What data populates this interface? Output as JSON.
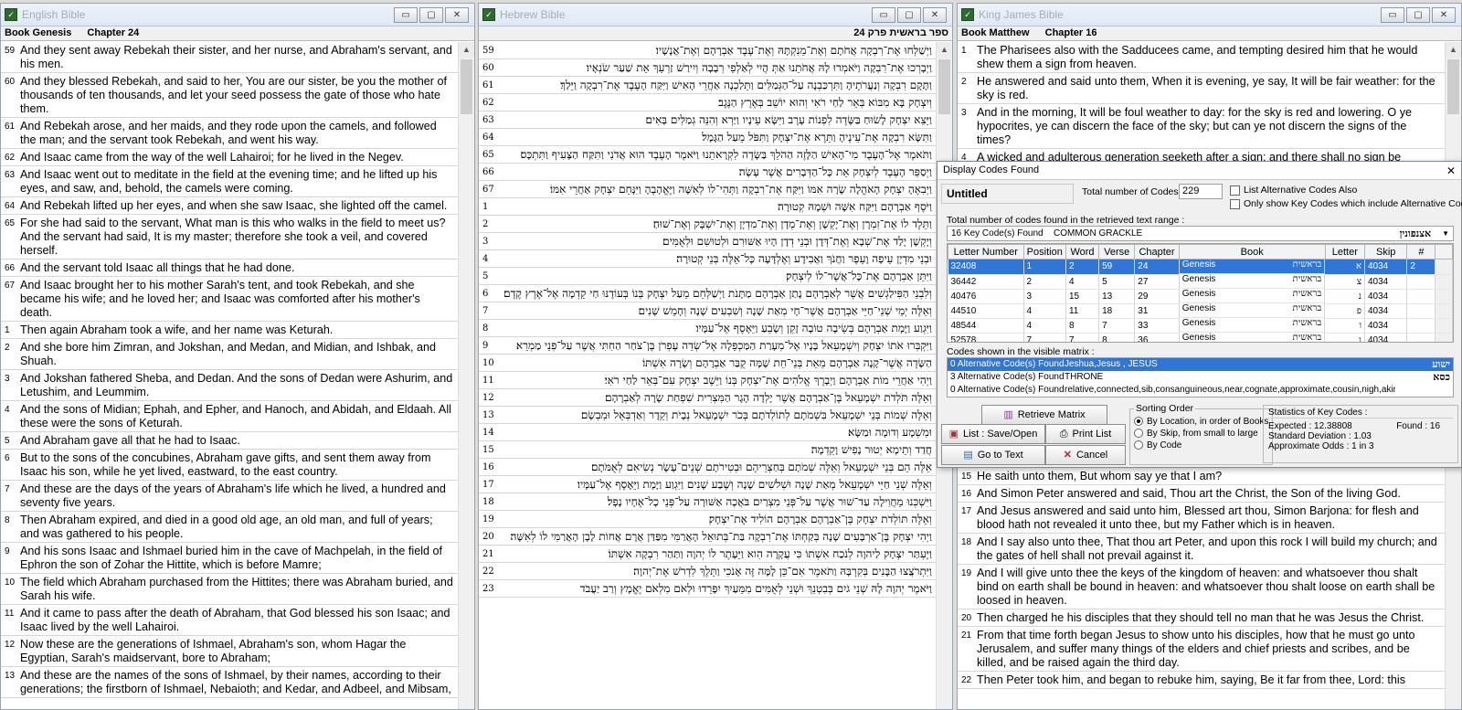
{
  "english": {
    "title": "English Bible",
    "book_label": "Book Genesis",
    "chapter_label": "Chapter 24",
    "verses": [
      {
        "n": "59",
        "t": "And they sent away Rebekah their sister, and her nurse, and Abraham's servant, and his men."
      },
      {
        "n": "60",
        "t": "And they blessed Rebekah, and said to her, You are our sister, be you the mother of thousands of ten thousands, and let your seed possess the gate of those who hate them."
      },
      {
        "n": "61",
        "t": "And Rebekah arose, and her maids, and they rode upon the camels, and followed the man; and the servant took Rebekah, and went his way."
      },
      {
        "n": "62",
        "t": "And Isaac came from the way of the well Lahairoi; for he lived in the Negev."
      },
      {
        "n": "63",
        "t": "And Isaac went out to meditate in the field at the evening time; and he lifted up his eyes, and saw, and, behold, the camels were coming."
      },
      {
        "n": "64",
        "t": "And Rebekah lifted up her eyes, and when she saw Isaac, she lighted off the camel."
      },
      {
        "n": "65",
        "t": "For she had said to the servant, What man is this who walks in the field to meet us? And the servant had said, It is my master; therefore she took a veil, and covered herself."
      },
      {
        "n": "66",
        "t": "And the servant told Isaac all things that he had done."
      },
      {
        "n": "67",
        "t": "And Isaac brought her to his mother Sarah's tent, and took Rebekah, and she became his wife; and he loved her; and Isaac was comforted after his mother's death."
      },
      {
        "n": "1",
        "t": "Then again Abraham took a wife, and her name was Keturah."
      },
      {
        "n": "2",
        "t": "And she bore him Zimran, and Jokshan, and Medan, and Midian, and Ishbak, and Shuah."
      },
      {
        "n": "3",
        "t": "And Jokshan fathered Sheba, and Dedan. And the sons of Dedan were Ashurim, and Letushim, and Leummim."
      },
      {
        "n": "4",
        "t": "And the sons of Midian; Ephah, and Epher, and Hanoch, and Abidah, and Eldaah. All these were the sons of Keturah."
      },
      {
        "n": "5",
        "t": "And Abraham gave all that he had to Isaac."
      },
      {
        "n": "6",
        "t": "But to the sons of the concubines, Abraham gave gifts, and sent them away from Isaac his son, while he yet lived, eastward, to the east country."
      },
      {
        "n": "7",
        "t": "And these are the days of the years of Abraham's life which he lived, a hundred and seventy five years."
      },
      {
        "n": "8",
        "t": "Then Abraham expired, and died in a good old age, an old man, and full of years; and was gathered to his people."
      },
      {
        "n": "9",
        "t": "And his sons Isaac and Ishmael buried him in the cave of Machpelah, in the field of Ephron the son of Zohar the Hittite, which is before Mamre;"
      },
      {
        "n": "10",
        "t": "The field which Abraham purchased from the Hittites; there was Abraham buried, and Sarah his wife."
      },
      {
        "n": "11",
        "t": "And it came to pass after the death of Abraham, that God blessed his son Isaac; and Isaac lived by the well Lahairoi."
      },
      {
        "n": "12",
        "t": "Now these are the generations of Ishmael, Abraham's son, whom Hagar the Egyptian, Sarah's maidservant, bore to Abraham;"
      },
      {
        "n": "13",
        "t": "And these are the names of the sons of Ishmael, by their names, according to their generations; the firstborn of Ishmael, Nebaioth; and Kedar, and Adbeel, and Mibsam,"
      }
    ]
  },
  "hebrew": {
    "title": "Hebrew Bible",
    "header": "ספר בראשית פרק 24",
    "verses": [
      {
        "n": "59",
        "t": "וַיְשַׁלְּחוּ אֶת־רִבְקָה אֲחֹתָם וְאֶת־מֵנִקְתָּהּ וְאֶת־עֶבֶד אַבְרָהָם וְאֶת־אֲנָשָׁיו׃"
      },
      {
        "n": "60",
        "t": "וַיְבָרְכוּ אֶת־רִבְקָה וַיֹּאמְרוּ לָהּ אֲחֹתֵנוּ אַתְּ הֲיִי לְאַלְפֵי רְבָבָה וְיִירַשׁ זַרְעֵךְ אֵת שַׁעַר שֹׂנְאָיו׃"
      },
      {
        "n": "61",
        "t": "וַתָּקָם רִבְקָה וְנַעֲרֹתֶיהָ וַתִּרְכַּבְנָה עַל־הַגְּמַלִּים וַתֵּלַכְנָה אַחֲרֵי הָאִישׁ וַיִּקַּח הָעֶבֶד אֶת־רִבְקָה וַיֵּלַךְ׃"
      },
      {
        "n": "62",
        "t": "וְיִצְחָק בָּא מִבּוֹא בְּאֵר לַחַי רֹאִי וְהוּא יוֹשֵׁב בְּאֶרֶץ הַנֶּגֶב׃"
      },
      {
        "n": "63",
        "t": "וַיֵּצֵא יִצְחָק לָשׂוּחַ בַּשָּׂדֶה לִפְנוֹת עָרֶב וַיִּשָּׂא עֵינָיו וַיַּרְא וְהִנֵּה גְמַלִּים בָּאִים׃"
      },
      {
        "n": "64",
        "t": "וַתִּשָּׂא רִבְקָה אֶת־עֵינֶיהָ וַתֵּרֶא אֶת־יִצְחָק וַתִּפֹּל מֵעַל הַגָּמָל׃"
      },
      {
        "n": "65",
        "t": "וַתֹּאמֶר אֶל־הָעֶבֶד מִי־הָאִישׁ הַלָּזֶה הַהֹלֵךְ בַּשָּׂדֶה לִקְרָאתֵנוּ וַיֹּאמֶר הָעֶבֶד הוּא אֲדֹנִי וַתִּקַּח הַצָּעִיף וַתִּתְכָּס׃"
      },
      {
        "n": "66",
        "t": "וַיְסַפֵּר הָעֶבֶד לְיִצְחָק אֵת כָּל־הַדְּבָרִים אֲשֶׁר עָשָׂה׃"
      },
      {
        "n": "67",
        "t": "וַיְבִאֶהָ יִצְחָק הָאֹהֱלָה שָׂרָה אִמּוֹ וַיִּקַּח אֶת־רִבְקָה וַתְּהִי־לוֹ לְאִשָּׁה וַיֶּאֱהָבֶהָ וַיִּנָּחֵם יִצְחָק אַחֲרֵי אִמּוֹ׃"
      },
      {
        "n": "1",
        "t": "וַיֹּסֶף אַבְרָהָם וַיִּקַּח אִשָּׁה וּשְׁמָהּ קְטוּרָה׃"
      },
      {
        "n": "2",
        "t": "וַתֵּלֶד לוֹ אֶת־זִמְרָן וְאֶת־יָקְשָׁן וְאֶת־מְדָן וְאֶת־מִדְיָן וְאֶת־יִשְׁבָּק וְאֶת־שׁוּחַ׃"
      },
      {
        "n": "3",
        "t": "וְיָקְשָׁן יָלַד אֶת־שְׁבָא וְאֶת־דְּדָן וּבְנֵי דְדָן הָיוּ אַשּׁוּרִם וּלְטוּשִׁם וּלְאֻמִּים׃"
      },
      {
        "n": "4",
        "t": "וּבְנֵי מִדְיָן עֵיפָה וָעֵפֶר וַחֲנֹךְ וַאֲבִידָע וְאֶלְדָּעָה כָּל־אֵלֶּה בְּנֵי קְטוּרָה׃"
      },
      {
        "n": "5",
        "t": "וַיִּתֵּן אַבְרָהָם אֶת־כָּל־אֲשֶׁר־לוֹ לְיִצְחָק׃"
      },
      {
        "n": "6",
        "t": "וְלִבְנֵי הַפִּילַגְשִׁים אֲשֶׁר לְאַבְרָהָם נָתַן אַבְרָהָם מַתָּנֹת וַיְשַׁלְּחֵם מֵעַל יִצְחָק בְּנוֹ בְּעוֹדֶנּוּ חַי קֵדְמָה אֶל־אֶרֶץ קֶדֶם׃"
      },
      {
        "n": "7",
        "t": "וְאֵלֶּה יְמֵי שְׁנֵי־חַיֵּי אַבְרָהָם אֲשֶׁר־חָי מְאַת שָׁנָה וְשִׁבְעִים שָׁנָה וְחָמֵשׁ שָׁנִים׃"
      },
      {
        "n": "8",
        "t": "וַיִּגְוַע וַיָּמָת אַבְרָהָם בְּשֵׂיבָה טוֹבָה זָקֵן וְשָׂבֵעַ וַיֵּאָסֶף אֶל־עַמָּיו׃"
      },
      {
        "n": "9",
        "t": "וַיִּקְבְּרוּ אֹתוֹ יִצְחָק וְיִשְׁמָעֵאל בָּנָיו אֶל־מְעָרַת הַמַּכְפֵּלָה אֶל־שְׂדֵה עֶפְרֹן בֶּן־צֹחַר הַחִתִּי אֲשֶׁר עַל־פְּנֵי מַמְרֵא׃"
      },
      {
        "n": "10",
        "t": "הַשָּׂדֶה אֲשֶׁר־קָנָה אַבְרָהָם מֵאֵת בְּנֵי־חֵת שָׁמָּה קֻבַּר אַבְרָהָם וְשָׂרָה אִשְׁתּוֹ׃"
      },
      {
        "n": "11",
        "t": "וַיְהִי אַחֲרֵי מוֹת אַבְרָהָם וַיְבָרֶךְ אֱלֹהִים אֶת־יִצְחָק בְּנוֹ וַיֵּשֶׁב יִצְחָק עִם־בְּאֵר לַחַי רֹאִי׃"
      },
      {
        "n": "12",
        "t": "וְאֵלֶּה תֹּלְדֹת יִשְׁמָעֵאל בֶּן־אַבְרָהָם אֲשֶׁר יָלְדָה הָגָר הַמִּצְרִית שִׁפְחַת שָׂרָה לְאַבְרָהָם׃"
      },
      {
        "n": "13",
        "t": "וְאֵלֶּה שְׁמוֹת בְּנֵי יִשְׁמָעֵאל בִּשְׁמֹתָם לְתוֹלְדֹתָם בְּכֹר יִשְׁמָעֵאל נְבָיֹת וְקֵדָר וְאַדְבְּאֵל וּמִבְשָׂם׃"
      },
      {
        "n": "14",
        "t": "וּמִשְׁמָע וְדוּמָה וּמַשָּׂא׃"
      },
      {
        "n": "15",
        "t": "חֲדַד וְתֵימָא יְטוּר נָפִישׁ וָקֵדְמָה׃"
      },
      {
        "n": "16",
        "t": "אֵלֶּה הֵם בְּנֵי יִשְׁמָעֵאל וְאֵלֶּה שְׁמֹתָם בְּחַצְרֵיהֶם וּבְטִירֹתָם שְׁנֵים־עָשָׂר נְשִׂיאִם לְאֻמֹּתָם׃"
      },
      {
        "n": "17",
        "t": "וְאֵלֶּה שְׁנֵי חַיֵּי יִשְׁמָעֵאל מְאַת שָׁנָה וּשְׁלֹשִׁים שָׁנָה וְשֶׁבַע שָׁנִים וַיִּגְוַע וַיָּמָת וַיֵּאָסֶף אֶל־עַמָּיו׃"
      },
      {
        "n": "18",
        "t": "וַיִּשְׁכְּנוּ מֵחֲוִילָה עַד־שׁוּר אֲשֶׁר עַל־פְּנֵי מִצְרַיִם בֹּאֲכָה אַשּׁוּרָה עַל־פְּנֵי כָל־אֶחָיו נָפָל׃"
      },
      {
        "n": "19",
        "t": "וְאֵלֶּה תּוֹלְדֹת יִצְחָק בֶּן־אַבְרָהָם אַבְרָהָם הוֹלִיד אֶת־יִצְחָק׃"
      },
      {
        "n": "20",
        "t": "וַיְהִי יִצְחָק בֶּן־אַרְבָּעִים שָׁנָה בְּקַחְתּוֹ אֶת־רִבְקָה בַּת־בְּתוּאֵל הָאֲרַמִּי מִפַּדַּן אֲרָם אֲחוֹת לָבָן הָאֲרַמִּי לוֹ לְאִשָּׁה׃"
      },
      {
        "n": "21",
        "t": "וַיֶּעְתַּר יִצְחָק לַיהוָה לְנֹכַח אִשְׁתּוֹ כִּי עֲקָרָה הִוא וַיֵּעָתֶר לוֹ יְהוָה וַתַּהַר רִבְקָה אִשְׁתּוֹ׃"
      },
      {
        "n": "22",
        "t": "וַיִּתְרֹצֲצוּ הַבָּנִים בְּקִרְבָּהּ וַתֹּאמֶר אִם־כֵּן לָמָּה זֶּה אָנֹכִי וַתֵּלֶךְ לִדְרֹשׁ אֶת־יְהוָה׃"
      },
      {
        "n": "23",
        "t": "וַיֹּאמֶר יְהוָה לָהּ שְׁנֵי גֹיִם בְּבִטְנֵךְ וּשְׁנֵי לְאֻמִּים מִמֵּעַיִךְ יִפָּרֵדוּ וּלְאֹם מִלְאֹם יֶאֱמָץ וְרַב יַעֲבֹד"
      }
    ]
  },
  "kjv": {
    "title": "King James Bible",
    "book_label": "Book Matthew",
    "chapter_label": "Chapter 16",
    "verses_top": [
      {
        "n": "1",
        "t": "The Pharisees also with the Sadducees came, and tempting desired him that he would shew them a sign from heaven."
      },
      {
        "n": "2",
        "t": "He answered and said unto them, When it is evening, ye say, It will be fair weather: for the sky is red."
      },
      {
        "n": "3",
        "t": "And in the morning, It will be foul weather to day: for the sky is red and lowering. O ye hypocrites, ye can discern the face of the sky; but can ye not discern the signs of the times?"
      },
      {
        "n": "4",
        "t": "A wicked and adulterous generation seeketh after a sign; and there shall no sign be"
      }
    ],
    "verses_bottom": [
      {
        "n": "15",
        "t": "He saith unto them, But whom say ye that I am?"
      },
      {
        "n": "16",
        "t": "And Simon Peter answered and said, Thou art the Christ, the Son of the living God."
      },
      {
        "n": "17",
        "t": "And Jesus answered and said unto him, Blessed art thou, Simon Barjona: for flesh and blood hath not revealed it unto thee, but my Father which is in heaven."
      },
      {
        "n": "18",
        "t": "And I say also unto thee, That thou art Peter, and upon this rock I will build my church; and the gates of hell shall not prevail against it."
      },
      {
        "n": "19",
        "t": "And I will give unto thee the keys of the kingdom of heaven: and whatsoever thou shalt bind on earth shall be bound in heaven: and whatsoever thou shalt loose on earth shall be loosed in heaven."
      },
      {
        "n": "20",
        "t": "Then charged he his disciples that they should tell no man that he was Jesus the Christ."
      },
      {
        "n": "21",
        "t": "From that time forth began Jesus to show unto his disciples, how that he must go unto Jerusalem, and suffer many things of the elders and chief priests and scribes, and be killed, and be raised again the third day."
      },
      {
        "n": "22",
        "t": "Then Peter took him, and began to rebuke him, saying, Be it far from thee, Lord: this"
      }
    ]
  },
  "dialog": {
    "title": "Display Codes Found",
    "doc_name": "Untitled",
    "total_label": "Total number of Codes found :",
    "total_value": "229",
    "alt_also": "List Alternative Codes Also",
    "only_key": "Only show Key Codes which include Alternative Codes",
    "range_label": "Total number of codes found in the retrieved text range :",
    "key_found": "16 Key Code(s) Found",
    "key_name": "COMMON GRACKLE",
    "key_hebrew": "אצנפונין",
    "columns": [
      "Letter Number",
      "Position",
      "Word",
      "Verse",
      "Chapter",
      "Book",
      "Letter",
      "Skip",
      "#"
    ],
    "rows": [
      {
        "letter_number": "32408",
        "position": "1",
        "word": "2",
        "verse": "59",
        "chapter": "24",
        "book": "Genesis",
        "book_heb": "בראשית",
        "letter": "א",
        "skip": "4034",
        "count": "2"
      },
      {
        "letter_number": "36442",
        "position": "2",
        "word": "4",
        "verse": "5",
        "chapter": "27",
        "book": "Genesis",
        "book_heb": "בראשית",
        "letter": "צ",
        "skip": "4034",
        "count": ""
      },
      {
        "letter_number": "40476",
        "position": "3",
        "word": "15",
        "verse": "13",
        "chapter": "29",
        "book": "Genesis",
        "book_heb": "בראשית",
        "letter": "נ",
        "skip": "4034",
        "count": ""
      },
      {
        "letter_number": "44510",
        "position": "4",
        "word": "11",
        "verse": "18",
        "chapter": "31",
        "book": "Genesis",
        "book_heb": "בראשית",
        "letter": "פ",
        "skip": "4034",
        "count": ""
      },
      {
        "letter_number": "48544",
        "position": "4",
        "word": "8",
        "verse": "7",
        "chapter": "33",
        "book": "Genesis",
        "book_heb": "בראשית",
        "letter": "ו",
        "skip": "4034",
        "count": ""
      },
      {
        "letter_number": "52578",
        "position": "7",
        "word": "7",
        "verse": "8",
        "chapter": "36",
        "book": "Genesis",
        "book_heb": "בראשית",
        "letter": "נ",
        "skip": "4034",
        "count": ""
      }
    ],
    "matrix_label": "Codes shown in the visible matrix :",
    "alt_rows": [
      {
        "c1": "0 Alternative Code(s) Found",
        "c2": "Jeshua,Jesus , JESUS",
        "c3": "ישוע"
      },
      {
        "c1": "3 Alternative Code(s) Found",
        "c2": "THRONE",
        "c3": "כסא"
      },
      {
        "c1": "0 Alternative Code(s) Found",
        "c2": "relative,connected,sib,consanguineous,near,cognate,approximate,cousin,nigh,akin,proximate,cl",
        "c3": ""
      }
    ],
    "btn_retrieve": "Retrieve Matrix",
    "btn_list": "List : Save/Open",
    "btn_print": "Print List",
    "btn_goto": "Go to Text",
    "btn_cancel": "Cancel",
    "sorting_title": "Sorting Order",
    "sort_opts": [
      "By Location, in order of Books",
      "By Skip, from small to large",
      "By Code"
    ],
    "stats_title": "Statistics of Key Codes :",
    "expected": "Expected :  12.38808",
    "found": "Found :  16",
    "stddev": "Standard Deviation :        1.03",
    "odds": "Approximate Odds :  1 in 3"
  }
}
